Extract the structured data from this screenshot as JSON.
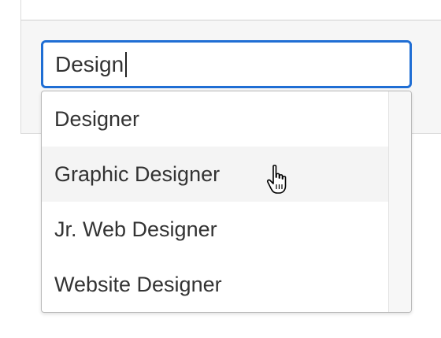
{
  "search": {
    "value": "Design"
  },
  "dropdown": {
    "options": [
      {
        "label": "Designer"
      },
      {
        "label": "Graphic Designer"
      },
      {
        "label": "Jr. Web Designer"
      },
      {
        "label": "Website Designer"
      }
    ],
    "hovered_index": 1
  },
  "colors": {
    "focus_border": "#1f6ed4",
    "hover_background": "#f4f4f4",
    "text": "#333333"
  },
  "icons": {
    "cursor": "hand-pointer-icon"
  }
}
